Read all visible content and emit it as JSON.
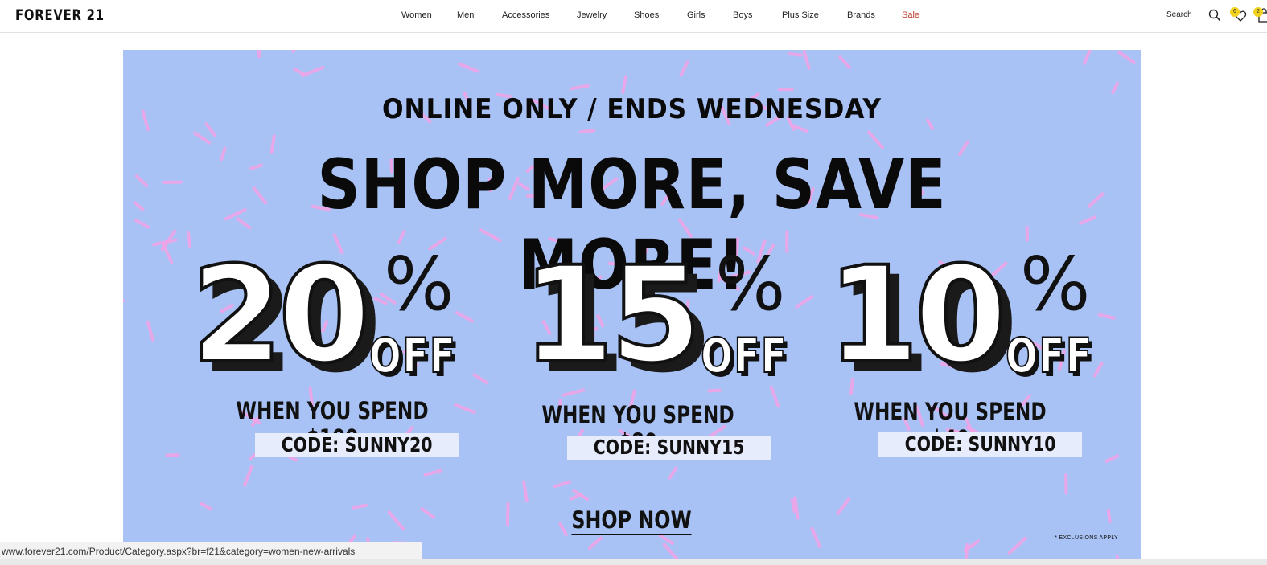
{
  "header": {
    "logo": "FOREVER 21",
    "nav": [
      "Women",
      "Men",
      "Accessories",
      "Jewelry",
      "Shoes",
      "Girls",
      "Boys",
      "Plus Size",
      "Brands",
      "Sale"
    ],
    "search_label": "Search",
    "wishlist_count": "6",
    "bag_count": "2",
    "sale_color": "#c0392b",
    "badge_color": "#f2d21c"
  },
  "banner": {
    "background_color": "#a9c2f5",
    "sprinkle_color": "#f3a3e6",
    "subhead": "ONLINE ONLY / ENDS WEDNESDAY",
    "headline": "SHOP MORE, SAVE MORE!",
    "offers": [
      {
        "number": "20",
        "percent": "%",
        "off": "OFF",
        "condition": "WHEN YOU SPEND $100",
        "code": "CODE: SUNNY20"
      },
      {
        "number": "15",
        "percent": "%",
        "off": "OFF",
        "condition": "WHEN YOU SPEND $80",
        "code": "CODE: SUNNY15"
      },
      {
        "number": "10",
        "percent": "%",
        "off": "OFF",
        "condition": "WHEN YOU SPEND $40",
        "code": "CODE: SUNNY10"
      }
    ],
    "cta": "SHOP NOW",
    "exclusions": "* EXCLUSIONS APPLY"
  },
  "status_bar": {
    "url": "www.forever21.com/Product/Category.aspx?br=f21&category=women-new-arrivals"
  }
}
